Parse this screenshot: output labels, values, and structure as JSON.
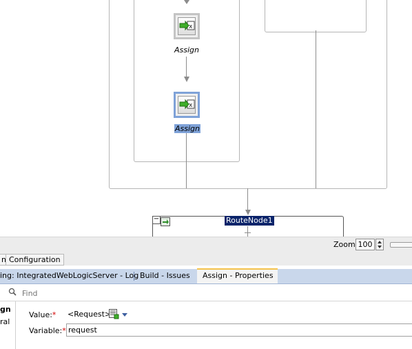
{
  "diagram": {
    "assign_label_1": "Assign",
    "assign_label_2": "Assign",
    "route_node_label": "RouteNode1",
    "collapse_symbol": "−"
  },
  "zoom": {
    "label": "Zoom:",
    "value": "100"
  },
  "editor_tabs": {
    "partial_tab": "n",
    "configuration_tab": "Configuration"
  },
  "log_tabs": [
    {
      "label": "ing: IntegratedWebLogicServer - Log"
    },
    {
      "label": "Build - Issues"
    },
    {
      "label": "Assign - Properties",
      "close": "×",
      "active": true
    }
  ],
  "find": {
    "placeholder": "Find"
  },
  "properties": {
    "left_panel_title": "gn",
    "left_panel_item": "ral",
    "value_label": "Value:",
    "value_text": "<Request>",
    "variable_label": "Variable:",
    "variable_value": "request",
    "required_mark": "*"
  },
  "colors": {
    "selection": "#7fa2d8",
    "log_tab_bar": "#c9d7eb",
    "active_tab_accent": "#f4c24a",
    "required": "#d40000"
  }
}
